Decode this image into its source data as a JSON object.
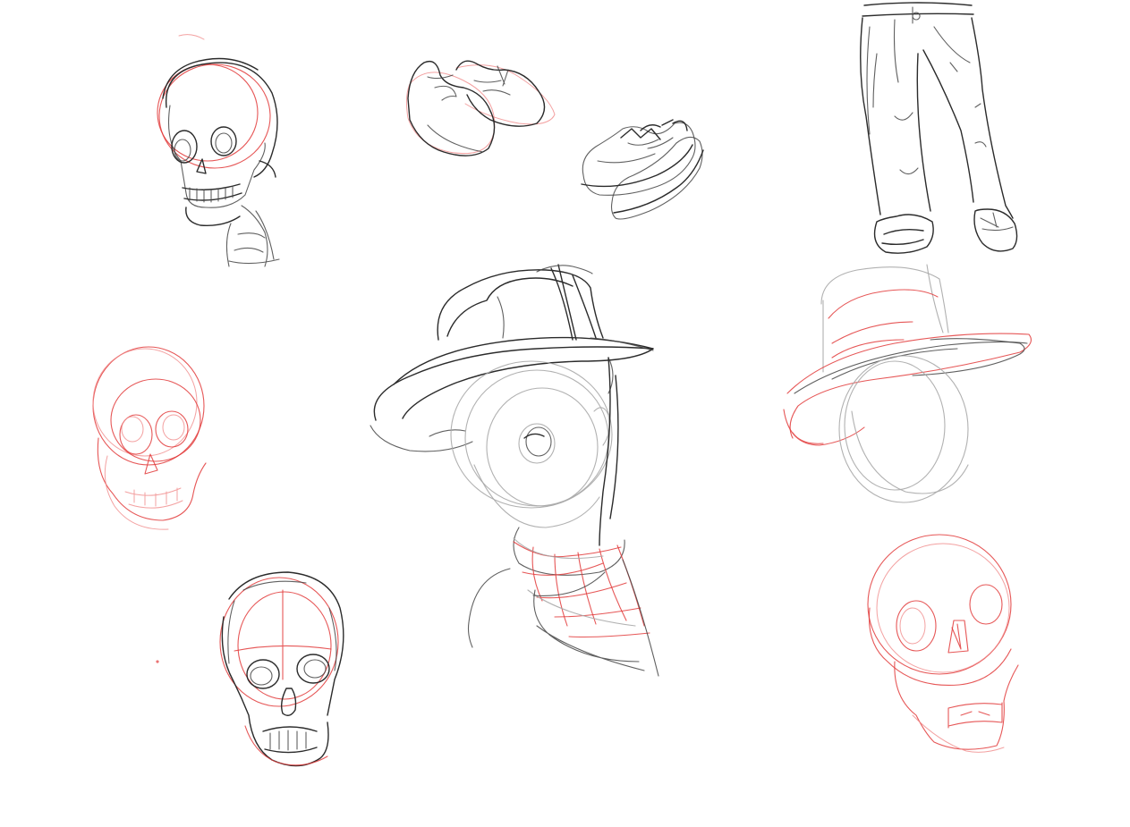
{
  "canvas": {
    "background": "#ffffff",
    "ink_colors": {
      "black": "#2b2b2b",
      "grey": "#a9a9a9",
      "red": "#e23a3a",
      "pink": "#f08a8a"
    }
  },
  "sketches": [
    {
      "name": "skull-sketch-top-left"
    },
    {
      "name": "shoes-sketch-top"
    },
    {
      "name": "sneakers-sketch-right"
    },
    {
      "name": "pants-sketch"
    },
    {
      "name": "skull-sketch-mid-left"
    },
    {
      "name": "figure-with-hat-sketch"
    },
    {
      "name": "hat-sketch-right"
    },
    {
      "name": "skull-sketch-bottom-left"
    },
    {
      "name": "skull-sketch-bottom-right"
    }
  ]
}
